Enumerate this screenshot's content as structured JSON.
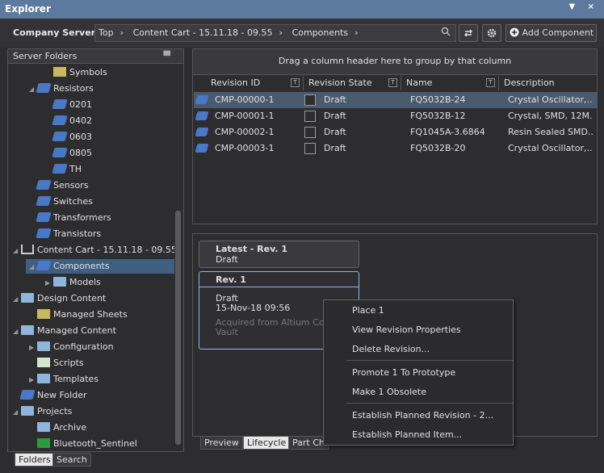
{
  "window": {
    "title": "Explorer",
    "controls": "▼ ×"
  },
  "toolbar": {
    "server": "Company Server",
    "server_caret": "▾",
    "crumbs": [
      "Top",
      "Content Cart - 15.11.18 - 09.55",
      "Components"
    ],
    "sep": "›",
    "add_label": "Add Component"
  },
  "left": {
    "header": "Server Folders",
    "pin": "▀",
    "tree": [
      {
        "label": "Symbols",
        "depth": 3,
        "icon": "symbols-icon"
      },
      {
        "label": "Resistors",
        "depth": 2,
        "icon": "component-icon",
        "expanded": true
      },
      {
        "label": "0201",
        "depth": 3,
        "icon": "component-icon"
      },
      {
        "label": "0402",
        "depth": 3,
        "icon": "component-icon"
      },
      {
        "label": "0603",
        "depth": 3,
        "icon": "component-icon"
      },
      {
        "label": "0805",
        "depth": 3,
        "icon": "component-icon"
      },
      {
        "label": "TH",
        "depth": 3,
        "icon": "component-icon"
      },
      {
        "label": "Sensors",
        "depth": 2,
        "icon": "component-icon"
      },
      {
        "label": "Switches",
        "depth": 2,
        "icon": "component-icon"
      },
      {
        "label": "Transformers",
        "depth": 2,
        "icon": "component-icon"
      },
      {
        "label": "Transistors",
        "depth": 2,
        "icon": "component-icon"
      },
      {
        "label": "Content Cart - 15.11.18 - 09.55",
        "depth": 1,
        "icon": "cart-icon",
        "expanded": true
      },
      {
        "label": "Components",
        "depth": 2,
        "icon": "component-icon",
        "expanded": true,
        "selected": true
      },
      {
        "label": "Models",
        "depth": 3,
        "icon": "folder-icon",
        "collapsed": true
      },
      {
        "label": "Design Content",
        "depth": 1,
        "icon": "folder-icon",
        "expanded": true
      },
      {
        "label": "Managed Sheets",
        "depth": 2,
        "icon": "sheet-icon"
      },
      {
        "label": "Managed Content",
        "depth": 1,
        "icon": "folder-icon",
        "expanded": true
      },
      {
        "label": "Configuration",
        "depth": 2,
        "icon": "folder-icon",
        "collapsed": true
      },
      {
        "label": "Scripts",
        "depth": 2,
        "icon": "script-icon"
      },
      {
        "label": "Templates",
        "depth": 2,
        "icon": "folder-icon",
        "collapsed": true
      },
      {
        "label": "New Folder",
        "depth": 1,
        "icon": "component-icon"
      },
      {
        "label": "Projects",
        "depth": 1,
        "icon": "folder-icon",
        "expanded": true
      },
      {
        "label": "Archive",
        "depth": 2,
        "icon": "folder-icon"
      },
      {
        "label": "Bluetooth_Sentinel",
        "depth": 2,
        "icon": "schematic-icon"
      }
    ],
    "tabs": [
      "Folders",
      "Search"
    ]
  },
  "grid": {
    "group_hint": "Drag a column header here to group by that column",
    "columns": [
      "Revision ID",
      "Revision State",
      "Name",
      "Description"
    ],
    "filter_glyph": "T",
    "rows": [
      {
        "id": "CMP-00000-1",
        "state": "Draft",
        "name": "FQ5032B-24",
        "desc": "Crystal Oscillator,..."
      },
      {
        "id": "CMP-00001-1",
        "state": "Draft",
        "name": "FQ5032B-12",
        "desc": "Crystal, SMD, 12M..."
      },
      {
        "id": "CMP-00002-1",
        "state": "Draft",
        "name": "FQ1045A-3.6864",
        "desc": "Resin Sealed SMD..."
      },
      {
        "id": "CMP-00003-1",
        "state": "Draft",
        "name": "FQ5032B-20",
        "desc": "Crystal Oscillator,..."
      }
    ]
  },
  "lifecycle": {
    "latest_title": "Latest - Rev. 1",
    "latest_state": "Draft",
    "rev_title": "Rev. 1",
    "rev_state": "Draft",
    "rev_date": "15-Nov-18 09:56",
    "rev_note1": "Acquired from Altium Con",
    "rev_note2": "Vault",
    "tabs": [
      "Preview",
      "Lifecycle",
      "Part Ch"
    ]
  },
  "context_menu": {
    "items": [
      "Place 1",
      "View Revision Properties",
      "Delete Revision...",
      "Promote 1 To Prototype",
      "Make 1 Obsolete",
      "Establish Planned Revision - 2...",
      "Establish Planned Item..."
    ]
  }
}
